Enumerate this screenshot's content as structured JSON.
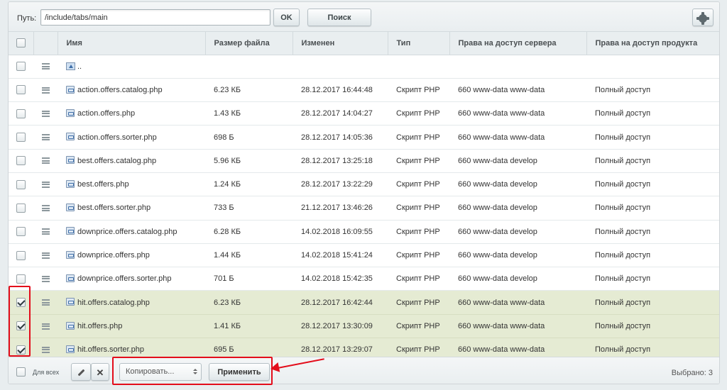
{
  "toolbar": {
    "path_label": "Путь:",
    "path_value": "/include/tabs/main",
    "ok_label": "OK",
    "search_label": "Поиск"
  },
  "columns": [
    "Имя",
    "Размер файла",
    "Изменен",
    "Тип",
    "Права на доступ сервера",
    "Права на доступ продукта"
  ],
  "parent_row": {
    "name": ".."
  },
  "rows": [
    {
      "name": "action.offers.catalog.php",
      "size": "6.23 КБ",
      "modified": "28.12.2017 16:44:48",
      "type": "Скрипт PHP",
      "server": "660 www-data www-data",
      "product": "Полный доступ",
      "checked": false
    },
    {
      "name": "action.offers.php",
      "size": "1.43 КБ",
      "modified": "28.12.2017 14:04:27",
      "type": "Скрипт PHP",
      "server": "660 www-data www-data",
      "product": "Полный доступ",
      "checked": false
    },
    {
      "name": "action.offers.sorter.php",
      "size": "698 Б",
      "modified": "28.12.2017 14:05:36",
      "type": "Скрипт PHP",
      "server": "660 www-data www-data",
      "product": "Полный доступ",
      "checked": false
    },
    {
      "name": "best.offers.catalog.php",
      "size": "5.96 КБ",
      "modified": "28.12.2017 13:25:18",
      "type": "Скрипт PHP",
      "server": "660 www-data develop",
      "product": "Полный доступ",
      "checked": false
    },
    {
      "name": "best.offers.php",
      "size": "1.24 КБ",
      "modified": "28.12.2017 13:22:29",
      "type": "Скрипт PHP",
      "server": "660 www-data develop",
      "product": "Полный доступ",
      "checked": false
    },
    {
      "name": "best.offers.sorter.php",
      "size": "733 Б",
      "modified": "21.12.2017 13:46:26",
      "type": "Скрипт PHP",
      "server": "660 www-data develop",
      "product": "Полный доступ",
      "checked": false
    },
    {
      "name": "downprice.offers.catalog.php",
      "size": "6.28 КБ",
      "modified": "14.02.2018 16:09:55",
      "type": "Скрипт PHP",
      "server": "660 www-data develop",
      "product": "Полный доступ",
      "checked": false
    },
    {
      "name": "downprice.offers.php",
      "size": "1.44 КБ",
      "modified": "14.02.2018 15:41:24",
      "type": "Скрипт PHP",
      "server": "660 www-data develop",
      "product": "Полный доступ",
      "checked": false
    },
    {
      "name": "downprice.offers.sorter.php",
      "size": "701 Б",
      "modified": "14.02.2018 15:42:35",
      "type": "Скрипт PHP",
      "server": "660 www-data develop",
      "product": "Полный доступ",
      "checked": false
    },
    {
      "name": "hit.offers.catalog.php",
      "size": "6.23 КБ",
      "modified": "28.12.2017 16:42:44",
      "type": "Скрипт PHP",
      "server": "660 www-data www-data",
      "product": "Полный доступ",
      "checked": true
    },
    {
      "name": "hit.offers.php",
      "size": "1.41 КБ",
      "modified": "28.12.2017 13:30:09",
      "type": "Скрипт PHP",
      "server": "660 www-data www-data",
      "product": "Полный доступ",
      "checked": true
    },
    {
      "name": "hit.offers.sorter.php",
      "size": "695 Б",
      "modified": "28.12.2017 13:29:07",
      "type": "Скрипт PHP",
      "server": "660 www-data www-data",
      "product": "Полный доступ",
      "checked": true
    }
  ],
  "footer": {
    "for_all_label": "Для всех",
    "action_select_value": "Копировать...",
    "apply_label": "Применить",
    "selected_count": "Выбрано: 3"
  },
  "colors": {
    "selected_row": "#e5ebd3",
    "highlight": "#e30d1b"
  }
}
